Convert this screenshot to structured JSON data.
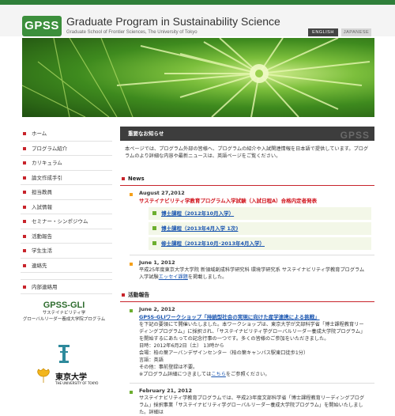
{
  "header": {
    "logo": "GPSS",
    "title": "Graduate Program in Sustainability Science",
    "subtitle": "Graduate School of Frontier Sciences, The University of Tokyo",
    "lang_en": "ENGLISH",
    "lang_ja": "JAPANESE"
  },
  "nav": {
    "items": [
      {
        "label": "ホーム"
      },
      {
        "label": "プログラム紹介"
      },
      {
        "label": "カリキュラム"
      },
      {
        "label": "論文作成手引"
      },
      {
        "label": "担当教員"
      },
      {
        "label": "入試情報"
      },
      {
        "label": "セミナー・シンポジウム"
      },
      {
        "label": "活動報告"
      },
      {
        "label": "学生生活"
      },
      {
        "label": "連絡先"
      }
    ],
    "internal": "内部連絡用"
  },
  "side_logos": {
    "gli": "GPSS-GLI",
    "gli_sub1": "サステイナビリティ学",
    "gli_sub2": "グローバルリーダー養成大学院プログラム",
    "ut_name": "東京大学",
    "ut_en": "THE UNIVERSITY OF TOKYO"
  },
  "notice": {
    "heading": "重要なお知らせ",
    "watermark": "GPSS",
    "text": "本ページでは、プログラム外部の皆様へ、プログラムの紹介や入試関連情報を日本語で提供しています。プログラムのより詳細な内容や最新ニュースは、英語ページをご覧ください。"
  },
  "news": {
    "heading": "News",
    "entries": [
      {
        "date": "August 27,2012",
        "title": "サステイナビリティ学教育プログラム入学試験（入試日程A）合格内定者発表",
        "links": [
          "博士課程（2012年10月入学）",
          "博士課程（2013年4月入学 1次)",
          "修士課程（2012年10月･2013年4月入学）"
        ]
      },
      {
        "date": "June 1, 2012",
        "body": "平成25年度東京大学大学院 新領域創成科学研究科 環境学研究系 サステイナビリティ学教育プログラム入学試験",
        "link": "エッセイ課題",
        "body_end": "を掲載しました。"
      }
    ]
  },
  "activity": {
    "heading": "活動報告",
    "entries": [
      {
        "date": "June 2, 2012",
        "title": "GPSS-GLIワークショップ「持続型社会の実現に向けた産学連携による挑戦」",
        "body": "を下記の要領にて開催いたしました。本ワークショップは、東京大学が文部科学省「博士課程教育リーディングプログラム」に採択され、「サステイナビリティ学グローバルリーダー養成大学院プログラム」を開始するにあたっての記念行事の一つです。多くの皆様のご参加をいただきました。",
        "details": [
          "日時：2012年6月2日（土） 13時から",
          "会場：柏の葉アーバンデザインセンター（柏の葉キャンパス駅東口徒歩1分）",
          "言語：英語",
          "その他：事前登録は不要。"
        ],
        "note": "※プログラム詳細につきましては",
        "note_link": "こちら",
        "note_end": "をご参照ください。"
      },
      {
        "date": "February 21, 2012",
        "body": "サステイナビリティ学教育プログラムでは、平成23年度文部科学省「博士課程教育リーディングプログラム」採択事業「サステイナビリティ学グローバルリーダー養成大学院プログラム」を開始いたしました。詳細は"
      }
    ]
  }
}
